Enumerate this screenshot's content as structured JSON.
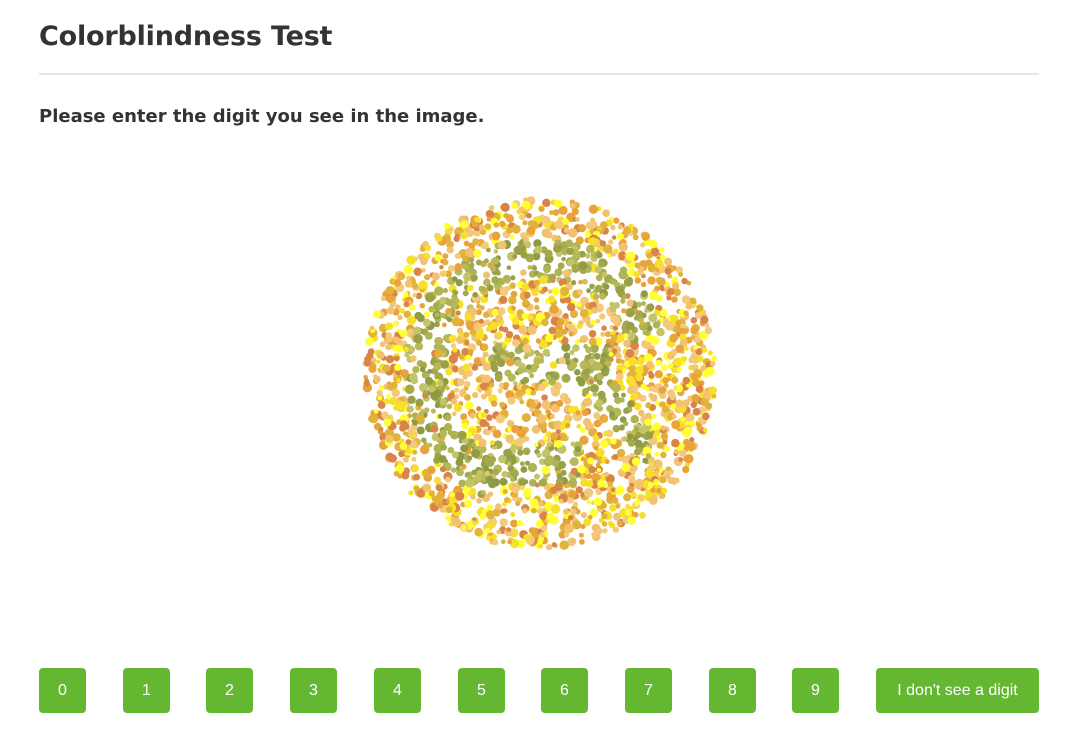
{
  "header": {
    "title": "Colorblindness Test"
  },
  "instruction": "Please enter the digit you see in the image.",
  "plate": {
    "icon": "ishihara-plate",
    "colors": {
      "background": [
        "#d9854a",
        "#e8a33a",
        "#f3c97c",
        "#f7e02a",
        "#ffff33",
        "#e3b23c",
        "#f2c270"
      ],
      "figure": [
        "#a4a94c",
        "#b7b858",
        "#9aa048",
        "#c3c46a",
        "#aeb456",
        "#8f9a45"
      ]
    }
  },
  "answers": {
    "digits": [
      "0",
      "1",
      "2",
      "3",
      "4",
      "5",
      "6",
      "7",
      "8",
      "9"
    ],
    "no_digit_label": "I don't see a digit"
  },
  "colors": {
    "button": "#63b731",
    "button_text": "#ffffff",
    "divider": "#e6e6e6",
    "text": "#333333"
  }
}
